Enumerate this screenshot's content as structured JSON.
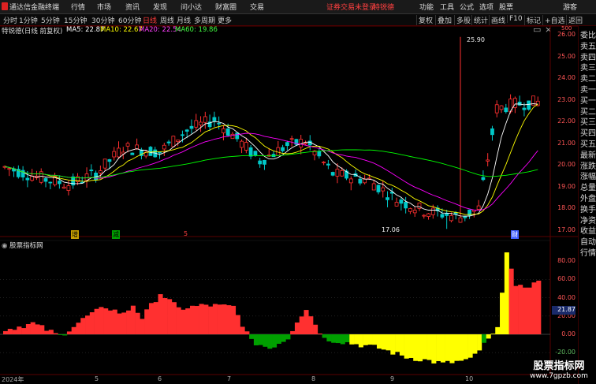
{
  "app": {
    "title": "通达信金融终端",
    "menu": [
      "行情",
      "市场",
      "资讯",
      "发现",
      "问小达",
      "财富圈",
      "交易"
    ],
    "login_warning": "证券交易未登录",
    "stock_badge": "特锐德",
    "right_menu": [
      "功能",
      "工具",
      "公式",
      "选项",
      "股票",
      "游客"
    ]
  },
  "toolbar": {
    "periods": [
      "分时",
      "1分钟",
      "5分钟",
      "15分钟",
      "30分钟",
      "60分钟",
      "日线",
      "周线",
      "月线",
      "多周期",
      "更多"
    ],
    "active_period": "日线",
    "right_buttons": [
      "复权",
      "叠加",
      "多股",
      "统计",
      "画线",
      "F10",
      "标记",
      "+自选",
      "返回"
    ]
  },
  "legend": {
    "stock": "特锐德(日线 前复权)",
    "ma5": "MA5: 22.87",
    "ma10": "MA10: 22.67",
    "ma20": "MA20: 22.54",
    "ma60": "MA60: 19.86"
  },
  "price_axis": [
    "26.00",
    "25.00",
    "24.00",
    "23.00",
    "22.00",
    "21.00",
    "20.00",
    "19.00",
    "18.00",
    "17.00"
  ],
  "price_axis_top": "500",
  "annotations": {
    "high": "25.90",
    "low": "17.06"
  },
  "event_tags": [
    "增",
    "减",
    "5",
    "财"
  ],
  "indicator": {
    "name": "股票指标网",
    "axis": [
      "80.00",
      "60.00",
      "40.00",
      "20.00",
      "0.00",
      "-20.00"
    ],
    "current_value": "21.87"
  },
  "x_axis": [
    "2024年",
    "5",
    "6",
    "7",
    "8",
    "9",
    "10"
  ],
  "side_panel": [
    "委比",
    "卖五",
    "卖四",
    "卖三",
    "卖二",
    "卖一",
    "买一",
    "买二",
    "买三",
    "买四",
    "买五",
    "最新",
    "涨跌",
    "涨幅",
    "总量",
    "外盘",
    "换手",
    "净资",
    "收益",
    "自动",
    "行情"
  ],
  "watermark": {
    "line1": "股票指标网",
    "line2": "www.7gpzb.com"
  },
  "colors": {
    "up": "#ff3030",
    "down": "#00c8c8",
    "ma5": "#ffffff",
    "ma10": "#ffff00",
    "ma20": "#ff00ff",
    "ma60": "#00ff00"
  }
}
